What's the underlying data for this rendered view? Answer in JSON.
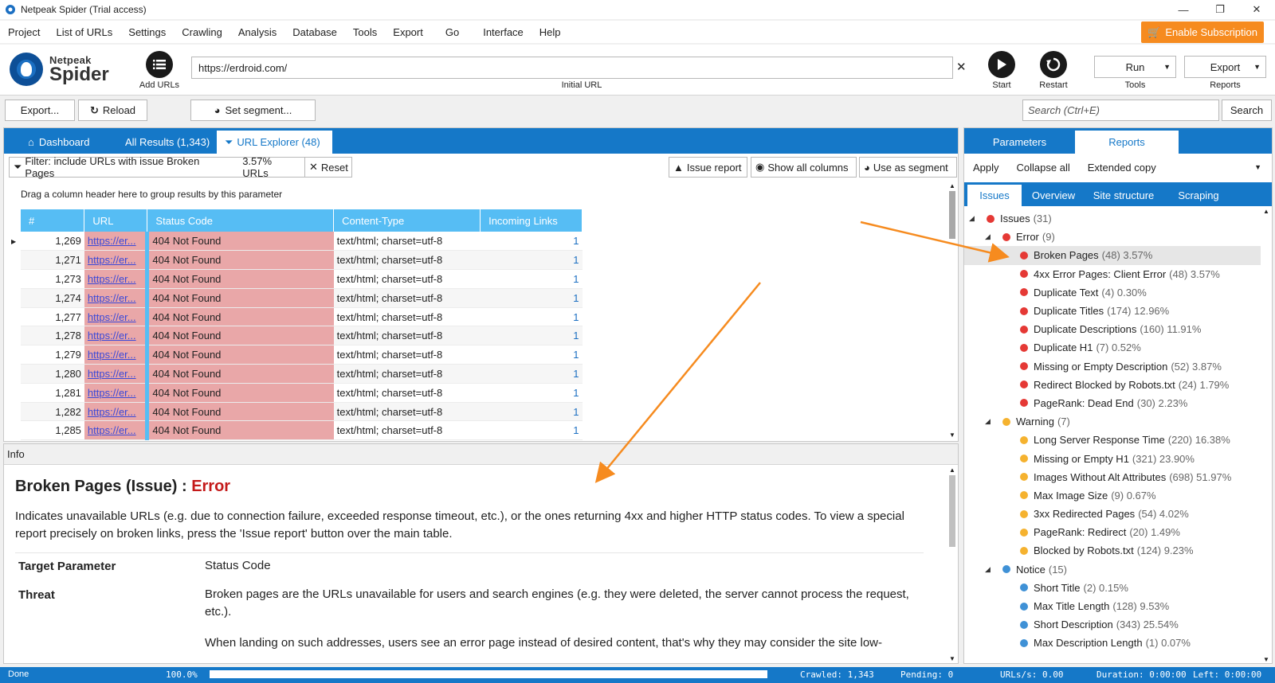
{
  "window": {
    "title": "Netpeak Spider (Trial access)",
    "minimize": "—",
    "maximize": "❐",
    "close": "✕"
  },
  "menu": [
    "Project",
    "List of URLs",
    "Settings",
    "Crawling",
    "Analysis",
    "Database",
    "Tools",
    "Export",
    "Go",
    "Interface",
    "Help"
  ],
  "subscription": {
    "label": "Enable Subscription",
    "color": "#f68b1f"
  },
  "logo": {
    "line1": "Netpeak",
    "line2": "Spider"
  },
  "toolbar": {
    "add_urls": "Add URLs",
    "url_value": "https://erdroid.com/",
    "url_caption": "Initial URL",
    "start": "Start",
    "restart": "Restart",
    "run": "Run",
    "tools": "Tools",
    "export": "Export",
    "reports": "Reports"
  },
  "actions": {
    "export": "Export...",
    "reload": "Reload",
    "set_segment": "Set segment...",
    "search_placeholder": "Search (Ctrl+E)",
    "search": "Search"
  },
  "tabs": {
    "dashboard": "Dashboard",
    "all_results": "All Results (1,343)",
    "url_explorer": "URL Explorer (48)"
  },
  "filter": {
    "text": "Filter: include URLs with issue Broken Pages",
    "percent": "3.57% URLs",
    "reset": "Reset",
    "issue_report": "Issue report",
    "show_all_columns": "Show all columns",
    "use_as_segment": "Use as segment"
  },
  "table": {
    "drag_hint": "Drag a column header here to group results by this parameter",
    "headers": [
      "#",
      "URL",
      "Status Code",
      "Content-Type",
      "Incoming Links"
    ],
    "rows": [
      [
        "1,269",
        "https://er...",
        "404 Not Found",
        "text/html; charset=utf-8",
        "1"
      ],
      [
        "1,271",
        "https://er...",
        "404 Not Found",
        "text/html; charset=utf-8",
        "1"
      ],
      [
        "1,273",
        "https://er...",
        "404 Not Found",
        "text/html; charset=utf-8",
        "1"
      ],
      [
        "1,274",
        "https://er...",
        "404 Not Found",
        "text/html; charset=utf-8",
        "1"
      ],
      [
        "1,277",
        "https://er...",
        "404 Not Found",
        "text/html; charset=utf-8",
        "1"
      ],
      [
        "1,278",
        "https://er...",
        "404 Not Found",
        "text/html; charset=utf-8",
        "1"
      ],
      [
        "1,279",
        "https://er...",
        "404 Not Found",
        "text/html; charset=utf-8",
        "1"
      ],
      [
        "1,280",
        "https://er...",
        "404 Not Found",
        "text/html; charset=utf-8",
        "1"
      ],
      [
        "1,281",
        "https://er...",
        "404 Not Found",
        "text/html; charset=utf-8",
        "1"
      ],
      [
        "1,282",
        "https://er...",
        "404 Not Found",
        "text/html; charset=utf-8",
        "1"
      ],
      [
        "1,285",
        "https://er...",
        "404 Not Found",
        "text/html; charset=utf-8",
        "1"
      ]
    ]
  },
  "info": {
    "header": "Info",
    "title": "Broken Pages (Issue) : ",
    "severity": "Error",
    "description": "Indicates unavailable URLs (e.g. due to connection failure, exceeded response timeout, etc.), or the ones returning 4xx and higher HTTP status codes. To view a special report precisely on broken links, press the 'Issue report' button over the main table.",
    "target_key": "Target Parameter",
    "target_value": "Status Code",
    "threat_key": "Threat",
    "threat_value": "Broken pages are the URLs unavailable for users and search engines (e.g. they were deleted, the server cannot process the request, etc.).",
    "threat_more": "When landing on such addresses, users see an error page instead of desired content, that's why they may consider the site low-"
  },
  "right": {
    "tabs": {
      "parameters": "Parameters",
      "reports": "Reports"
    },
    "actions": {
      "apply": "Apply",
      "collapse": "Collapse all",
      "extended": "Extended copy"
    },
    "subtabs": {
      "issues": "Issues",
      "overview": "Overview",
      "structure": "Site structure",
      "scraping": "Scraping"
    },
    "colors": {
      "error": "#e53935",
      "warning": "#f5b22f",
      "notice": "#3f91d6"
    },
    "tree": [
      {
        "label": "Issues",
        "count": "(31)",
        "level": 0,
        "color": "error"
      },
      {
        "label": "Error",
        "count": "(9)",
        "level": 1,
        "color": "error"
      },
      {
        "label": "Broken Pages",
        "count": "(48) 3.57%",
        "level": 2,
        "color": "error",
        "selected": true
      },
      {
        "label": "4xx Error Pages: Client Error",
        "count": "(48) 3.57%",
        "level": 2,
        "color": "error"
      },
      {
        "label": "Duplicate Text",
        "count": "(4) 0.30%",
        "level": 2,
        "color": "error"
      },
      {
        "label": "Duplicate Titles",
        "count": "(174) 12.96%",
        "level": 2,
        "color": "error"
      },
      {
        "label": "Duplicate Descriptions",
        "count": "(160) 11.91%",
        "level": 2,
        "color": "error"
      },
      {
        "label": "Duplicate H1",
        "count": "(7) 0.52%",
        "level": 2,
        "color": "error"
      },
      {
        "label": "Missing or Empty Description",
        "count": "(52) 3.87%",
        "level": 2,
        "color": "error"
      },
      {
        "label": "Redirect Blocked by Robots.txt",
        "count": "(24) 1.79%",
        "level": 2,
        "color": "error"
      },
      {
        "label": "PageRank: Dead End",
        "count": "(30) 2.23%",
        "level": 2,
        "color": "error"
      },
      {
        "label": "Warning",
        "count": "(7)",
        "level": 1,
        "color": "warning"
      },
      {
        "label": "Long Server Response Time",
        "count": "(220) 16.38%",
        "level": 2,
        "color": "warning"
      },
      {
        "label": "Missing or Empty H1",
        "count": "(321) 23.90%",
        "level": 2,
        "color": "warning"
      },
      {
        "label": "Images Without Alt Attributes",
        "count": "(698) 51.97%",
        "level": 2,
        "color": "warning"
      },
      {
        "label": "Max Image Size",
        "count": "(9) 0.67%",
        "level": 2,
        "color": "warning"
      },
      {
        "label": "3xx Redirected Pages",
        "count": "(54) 4.02%",
        "level": 2,
        "color": "warning"
      },
      {
        "label": "PageRank: Redirect",
        "count": "(20) 1.49%",
        "level": 2,
        "color": "warning"
      },
      {
        "label": "Blocked by Robots.txt",
        "count": "(124) 9.23%",
        "level": 2,
        "color": "warning"
      },
      {
        "label": "Notice",
        "count": "(15)",
        "level": 1,
        "color": "notice"
      },
      {
        "label": "Short Title",
        "count": "(2) 0.15%",
        "level": 2,
        "color": "notice"
      },
      {
        "label": "Max Title Length",
        "count": "(128) 9.53%",
        "level": 2,
        "color": "notice"
      },
      {
        "label": "Short Description",
        "count": "(343) 25.54%",
        "level": 2,
        "color": "notice"
      },
      {
        "label": "Max Description Length",
        "count": "(1) 0.07%",
        "level": 2,
        "color": "notice"
      }
    ]
  },
  "status": {
    "state": "Done",
    "percent": "100.0%",
    "progress": 1.0,
    "crawled": "Crawled: 1,343",
    "pending": "Pending: 0",
    "urls_per_sec": "URLs/s: 0.00",
    "duration": "Duration: 0:00:00",
    "left": "Left: 0:00:00"
  },
  "annotation_color": "#f68b1f"
}
